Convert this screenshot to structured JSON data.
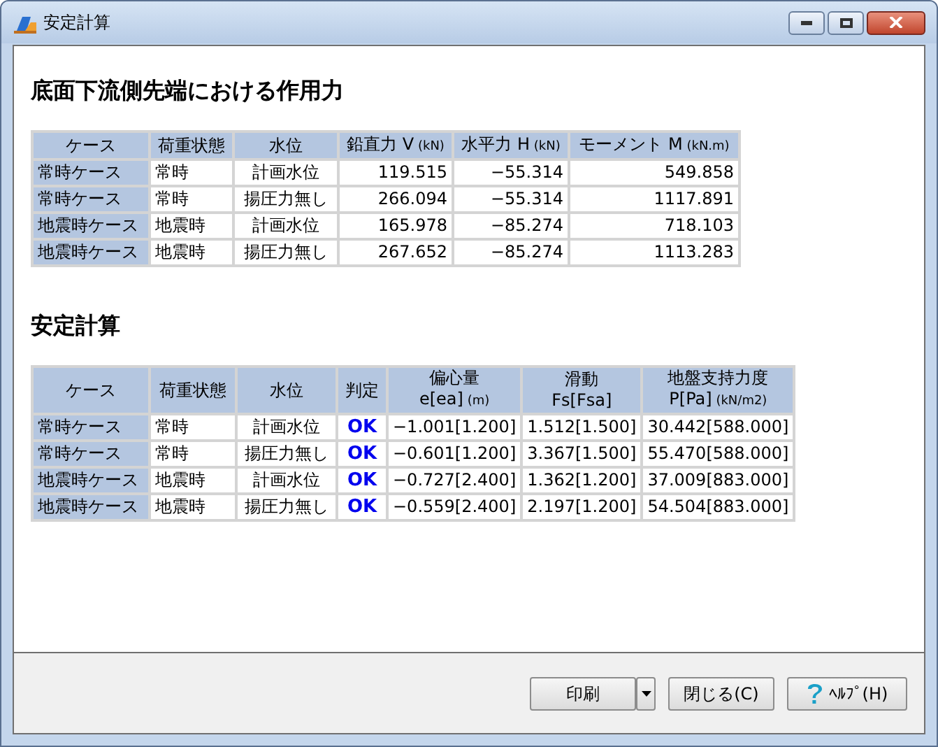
{
  "window": {
    "title": "安定計算"
  },
  "sections": [
    {
      "heading": "底面下流側先端における作用力",
      "table": {
        "columns": [
          {
            "label": "ケース"
          },
          {
            "label": "荷重状態"
          },
          {
            "label": "水位"
          },
          {
            "label": "鉛直力 V",
            "unit": "(kN)"
          },
          {
            "label": "水平力 H",
            "unit": "(kN)"
          },
          {
            "label": "モーメント M",
            "unit": "(kN.m)"
          }
        ],
        "rows": [
          [
            "常時ケース",
            "常時",
            "計画水位",
            "119.515",
            "−55.314",
            "549.858"
          ],
          [
            "常時ケース",
            "常時",
            "揚圧力無し",
            "266.094",
            "−55.314",
            "1117.891"
          ],
          [
            "地震時ケース",
            "地震時",
            "計画水位",
            "165.978",
            "−85.274",
            "718.103"
          ],
          [
            "地震時ケース",
            "地震時",
            "揚圧力無し",
            "267.652",
            "−85.274",
            "1113.283"
          ]
        ]
      }
    },
    {
      "heading": "安定計算",
      "table": {
        "columns": [
          {
            "label": "ケース"
          },
          {
            "label": "荷重状態"
          },
          {
            "label": "水位"
          },
          {
            "label": "判定"
          },
          {
            "label": "偏心量",
            "sub": "e[ea]",
            "unit": "(m)"
          },
          {
            "label": "滑動",
            "sub": "Fs[Fsa]"
          },
          {
            "label": "地盤支持力度",
            "sub": "P[Pa]",
            "unit": "(kN/m2)"
          }
        ],
        "rows": [
          [
            "常時ケース",
            "常時",
            "計画水位",
            "OK",
            "−1.001[1.200]",
            "1.512[1.500]",
            "30.442[588.000]"
          ],
          [
            "常時ケース",
            "常時",
            "揚圧力無し",
            "OK",
            "−0.601[1.200]",
            "3.367[1.500]",
            "55.470[588.000]"
          ],
          [
            "地震時ケース",
            "地震時",
            "計画水位",
            "OK",
            "−0.727[2.400]",
            "1.362[1.200]",
            "37.009[883.000]"
          ],
          [
            "地震時ケース",
            "地震時",
            "揚圧力無し",
            "OK",
            "−0.559[2.400]",
            "2.197[1.200]",
            "54.504[883.000]"
          ]
        ]
      }
    }
  ],
  "buttons": [
    {
      "kind": "split",
      "label": "印刷"
    },
    {
      "kind": "plain",
      "label": "閉じる(C)"
    },
    {
      "kind": "help",
      "label": "ﾍﾙﾌﾟ(H)"
    }
  ]
}
